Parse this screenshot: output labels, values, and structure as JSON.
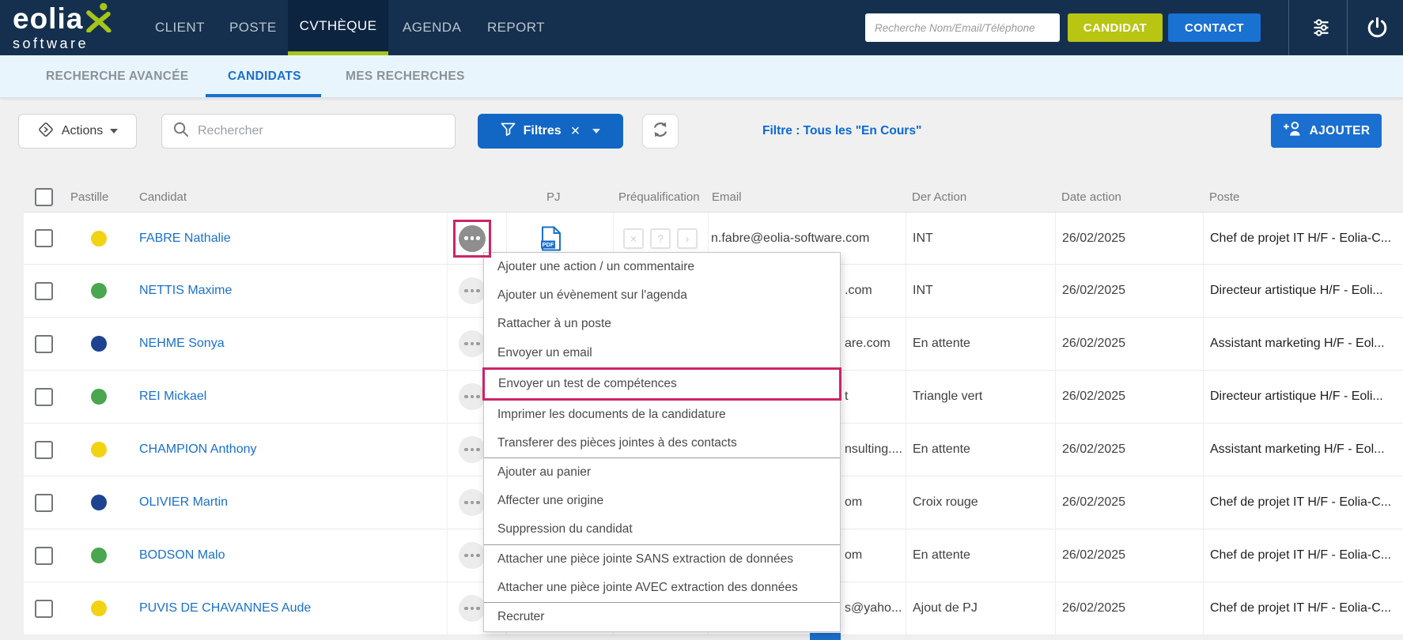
{
  "navbar": {
    "logo": {
      "line1": "eolia",
      "line2": "software"
    },
    "items": [
      {
        "label": "CLIENT",
        "active": false
      },
      {
        "label": "POSTE",
        "active": false
      },
      {
        "label": "CVTHÈQUE",
        "active": true
      },
      {
        "label": "AGENDA",
        "active": false
      },
      {
        "label": "REPORT",
        "active": false
      }
    ],
    "search_placeholder": "Recherche Nom/Email/Téléphone",
    "candidat_button": "CANDIDAT",
    "contact_button": "CONTACT",
    "colors": {
      "navy": "#15304e",
      "active_navy": "#0c2440",
      "green_accent": "#a4c61a",
      "candidat_btn": "#b8c513",
      "contact_btn": "#1971d2"
    }
  },
  "subnav": {
    "tabs": [
      {
        "label": "RECHERCHE AVANCÉE",
        "active": false
      },
      {
        "label": "CANDIDATS",
        "active": true
      },
      {
        "label": "MES RECHERCHES",
        "active": false
      }
    ],
    "active_color": "#1a70cc"
  },
  "toolbar": {
    "actions_label": "Actions",
    "search_placeholder": "Rechercher",
    "filtres_label": "Filtres",
    "close_glyph": "×",
    "filter_status": "Filtre : Tous les \"En Cours\"",
    "ajouter_label": "AJOUTER"
  },
  "table": {
    "columns": [
      "Pastille",
      "Candidat",
      "PJ",
      "Préqualification",
      "Email",
      "Der Action",
      "Date action",
      "Poste"
    ],
    "pdf_label": "PDF",
    "prequal_icons": [
      {
        "name": "reject-icon",
        "glyph": "×"
      },
      {
        "name": "question-icon",
        "glyph": "?"
      },
      {
        "name": "next-icon",
        "glyph": "›"
      }
    ],
    "pastille_colors": {
      "yellow": "#f2d213",
      "green": "#4aa64f",
      "navy": "#1e4390"
    },
    "rows": [
      {
        "pastille": "#f2d213",
        "pastille_name": "yellow",
        "candidat": "FABRE Nathalie",
        "email": "n.fabre@eolia-software.com",
        "der_action": "INT",
        "date_action": "26/02/2025",
        "poste": "Chef de projet IT H/F - Eolia-C..."
      },
      {
        "pastille": "#4aa64f",
        "pastille_name": "green",
        "candidat": "NETTIS Maxime",
        "email": ".com",
        "der_action": "INT",
        "date_action": "26/02/2025",
        "poste": "Directeur artistique H/F - Eoli..."
      },
      {
        "pastille": "#1e4390",
        "pastille_name": "navy",
        "candidat": "NEHME Sonya",
        "email": "are.com",
        "der_action": "En attente",
        "date_action": "26/02/2025",
        "poste": "Assistant marketing H/F - Eol..."
      },
      {
        "pastille": "#4aa64f",
        "pastille_name": "green",
        "candidat": "REI Mickael",
        "email": "t",
        "der_action": "Triangle vert",
        "date_action": "26/02/2025",
        "poste": "Directeur artistique H/F - Eoli..."
      },
      {
        "pastille": "#f2d213",
        "pastille_name": "yellow",
        "candidat": "CHAMPION Anthony",
        "email": "nsulting....",
        "der_action": "En attente",
        "date_action": "26/02/2025",
        "poste": "Assistant marketing H/F - Eol..."
      },
      {
        "pastille": "#1e4390",
        "pastille_name": "navy",
        "candidat": "OLIVIER Martin",
        "email": "om",
        "der_action": "Croix rouge",
        "date_action": "26/02/2025",
        "poste": "Chef de projet IT H/F - Eolia-C..."
      },
      {
        "pastille": "#4aa64f",
        "pastille_name": "green",
        "candidat": "BODSON Malo",
        "email": "om",
        "der_action": "En attente",
        "date_action": "26/02/2025",
        "poste": "Chef de projet IT H/F - Eolia-C..."
      },
      {
        "pastille": "#f2d213",
        "pastille_name": "yellow",
        "candidat": "PUVIS DE CHAVANNES Aude",
        "email": "s@yaho...",
        "der_action": "Ajout de PJ",
        "date_action": "26/02/2025",
        "poste": "Chef de projet IT H/F - Eolia-C..."
      }
    ]
  },
  "context_menu": {
    "highlight_color": "#cb2568",
    "items": [
      {
        "label": "Ajouter une action / un commentaire"
      },
      {
        "label": "Ajouter un évènement sur l'agenda"
      },
      {
        "label": "Rattacher à un poste"
      },
      {
        "label": "Envoyer un email"
      },
      {
        "label": "Envoyer un test de compétences",
        "highlighted": true
      },
      {
        "label": "Imprimer les documents de la candidature"
      },
      {
        "label": "Transferer des pièces jointes à des contacts"
      },
      {
        "label": "Ajouter au panier"
      },
      {
        "label": "Affecter une origine"
      },
      {
        "label": "Suppression du candidat"
      },
      {
        "label": "Attacher une pièce jointe SANS extraction de données"
      },
      {
        "label": "Attacher une pièce jointe AVEC extraction des données"
      },
      {
        "label": "Recruter"
      }
    ]
  }
}
